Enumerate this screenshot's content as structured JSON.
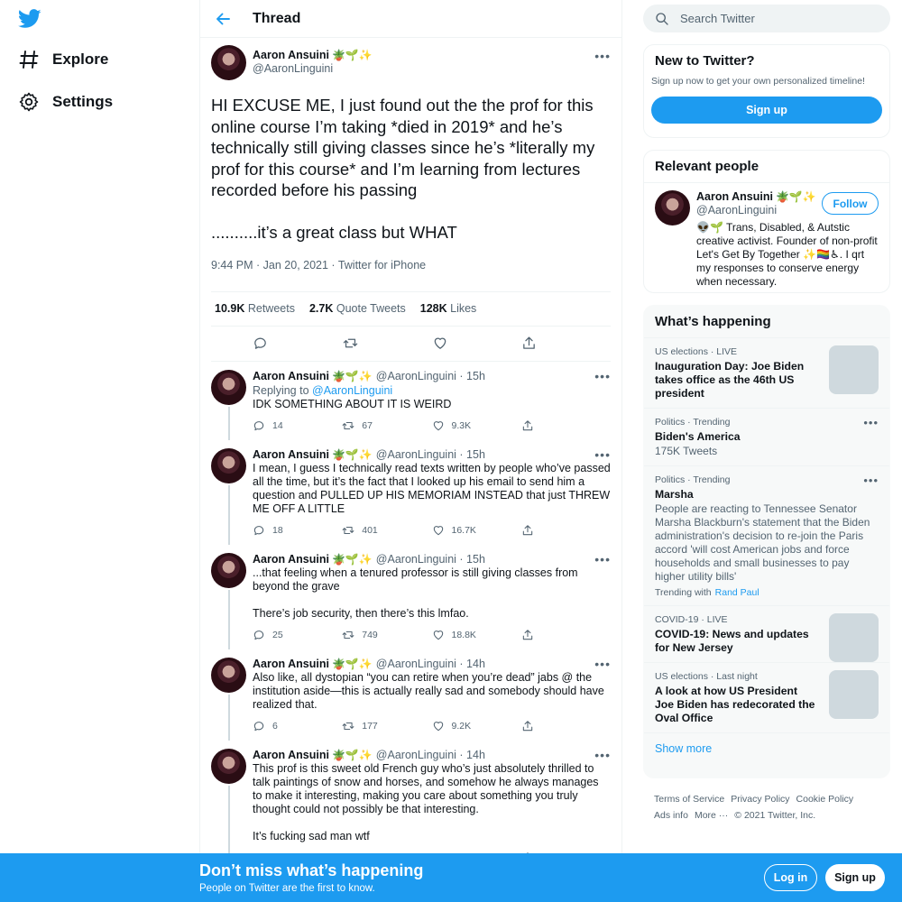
{
  "nav": {
    "explore_label": "Explore",
    "settings_label": "Settings"
  },
  "header": {
    "title": "Thread"
  },
  "main_tweet": {
    "name": "Aaron Ansuini",
    "name_emoji": "🪴🌱✨",
    "handle": "@AaronLinguini",
    "text": "HI EXCUSE ME, I just found out the the prof for this online course I’m taking *died in 2019* and he’s technically still giving classes since he’s *literally my prof for this course* and I’m learning from lectures recorded before his passing\n\n..........it’s a great class but WHAT",
    "meta": "9:44 PM · Jan 20, 2021 · Twitter for iPhone",
    "retweets_count": "10.9K",
    "retweets_label": "Retweets",
    "quotes_count": "2.7K",
    "quotes_label": "Quote Tweets",
    "likes_count": "128K",
    "likes_label": "Likes"
  },
  "replies": [
    {
      "name": "Aaron Ansuini",
      "emoji": "🪴🌱✨",
      "handle": "@AaronLinguini",
      "time": "15h",
      "replying_prefix": "Replying to",
      "replying_to": "@AaronLinguini",
      "text": "IDK SOMETHING ABOUT IT IS WEIRD",
      "replies": "14",
      "retweets": "67",
      "likes": "9.3K"
    },
    {
      "name": "Aaron Ansuini",
      "emoji": "🪴🌱✨",
      "handle": "@AaronLinguini",
      "time": "15h",
      "text": "I mean, I guess I technically read texts written by people who’ve passed all the time, but it’s the fact that I looked up his email to send him a question and PULLED UP HIS MEMORIAM INSTEAD that just THREW ME OFF A LITTLE",
      "replies": "18",
      "retweets": "401",
      "likes": "16.7K"
    },
    {
      "name": "Aaron Ansuini",
      "emoji": "🪴🌱✨",
      "handle": "@AaronLinguini",
      "time": "15h",
      "text": "...that feeling when a tenured professor is still giving classes from beyond the grave\n\nThere’s job security, then there’s this lmfao.",
      "replies": "25",
      "retweets": "749",
      "likes": "18.8K"
    },
    {
      "name": "Aaron Ansuini",
      "emoji": "🪴🌱✨",
      "handle": "@AaronLinguini",
      "time": "14h",
      "text": "Also like, all dystopian “you can retire when you’re dead” jabs @ the institution aside—this is actually really sad and somebody should have realized that.",
      "replies": "6",
      "retweets": "177",
      "likes": "9.2K"
    },
    {
      "name": "Aaron Ansuini",
      "emoji": "🪴🌱✨",
      "handle": "@AaronLinguini",
      "time": "14h",
      "text": "This prof is this sweet old French guy who’s just absolutely thrilled to talk paintings of snow and horses, and somehow he always manages to make it interesting, making you care about something you truly thought could not possibly be that interesting.\n\nIt’s fucking sad man wtf",
      "replies": "21",
      "retweets": "161",
      "likes": "10.5K"
    }
  ],
  "search": {
    "placeholder": "Search Twitter"
  },
  "new_to_twitter": {
    "title": "New to Twitter?",
    "subtitle": "Sign up now to get your own personalized timeline!",
    "signup_label": "Sign up"
  },
  "relevant_people": {
    "title": "Relevant people",
    "name": "Aaron Ansuini",
    "emoji": "🪴🌱✨",
    "handle": "@AaronLinguini",
    "follow_label": "Follow",
    "bio": "👽🌱 Trans, Disabled, & Autstic creative activist. Founder of non-profit Let's Get By Together ✨🏳️‍🌈♿. I qrt my responses to conserve energy when necessary."
  },
  "whats_happening": {
    "title": "What’s happening",
    "trends": [
      {
        "meta": "US elections · LIVE",
        "title": "Inauguration Day: Joe Biden takes office as the 46th US president",
        "has_thumb": true
      },
      {
        "meta": "Politics · Trending",
        "title": "Biden's America",
        "desc": "175K Tweets"
      },
      {
        "meta": "Politics · Trending",
        "title": "Marsha",
        "desc": "People are reacting to Tennessee Senator Marsha Blackburn's statement that the Biden administration's decision to re-join the Paris accord 'will cost American jobs and force households and small businesses to pay higher utility bills'",
        "sub_prefix": "Trending with",
        "sub_link": "Rand Paul"
      },
      {
        "meta": "COVID-19 · LIVE",
        "title": "COVID-19: News and updates for New Jersey",
        "has_thumb": true
      },
      {
        "meta": "US elections · Last night",
        "title": "A look at how US President Joe Biden has redecorated the Oval Office",
        "has_thumb": true
      }
    ],
    "show_more": "Show more"
  },
  "footer": {
    "terms": "Terms of Service",
    "privacy": "Privacy Policy",
    "cookie": "Cookie Policy",
    "ads": "Ads info",
    "more": "More ···",
    "copyright": "© 2021 Twitter, Inc."
  },
  "banner": {
    "title": "Don’t miss what’s happening",
    "subtitle": "People on Twitter are the first to know.",
    "login_label": "Log in",
    "signup_label": "Sign up"
  },
  "colors": {
    "accent": "#1d9bf0",
    "text": "#0f1419",
    "muted": "#536471"
  }
}
